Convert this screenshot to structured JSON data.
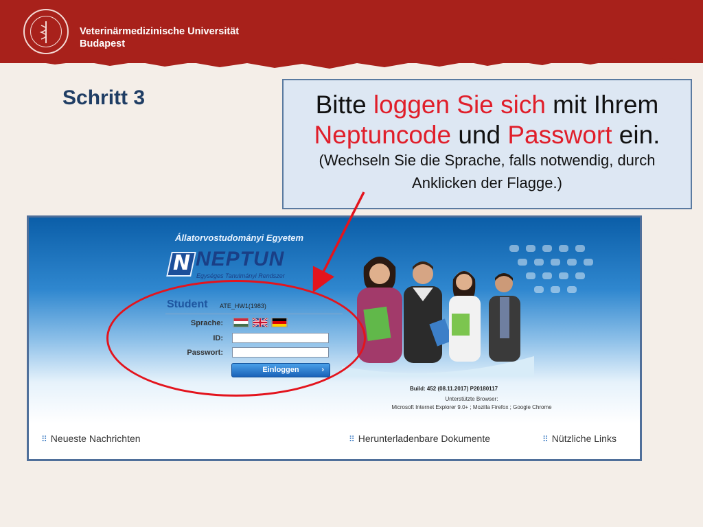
{
  "slide": {
    "university_name_line1": "Veterinärmedizinische Universität",
    "university_name_line2": "Budapest",
    "step_label": "Schritt 3",
    "colors": {
      "header": "#a8211b",
      "step": "#1f3d64",
      "highlight": "#e01e2a",
      "callout_bg": "#dde7f3"
    }
  },
  "callout": {
    "w1": "Bitte ",
    "w2": "loggen Sie sich",
    "w3": " mit Ihrem",
    "w4": "Neptuncode",
    "w5": " und ",
    "w6": "Passwort",
    "w7": " ein.",
    "hint_line1": "(Wechseln Sie die Sprache, falls notwendig, durch",
    "hint_line2": "Anklicken der Flagge.)"
  },
  "neptun": {
    "institution": "Állatorvostudományi Egyetem",
    "logo_text": "NEPTUN",
    "logo_letter": "N",
    "logo_subtitle": "Egységes Tanulmányi Rendszer",
    "login": {
      "title": "Student",
      "code": "ATE_HW1(1983)",
      "language_label": "Sprache:",
      "id_label": "ID:",
      "password_label": "Passwort:",
      "id_value": "",
      "password_value": "",
      "login_button": "Einloggen",
      "login_arrow": "›"
    },
    "build": "Build: 452 (08.11.2017) P20180117",
    "browsers_title": "Unterstützte Browser:",
    "browsers_list": "Microsoft Internet Explorer 9.0+ ; Mozilla Firefox ; Google Chrome",
    "footer_links": [
      "Neueste Nachrichten",
      "Herunterladenbare Dokumente",
      "Nützliche Links"
    ],
    "grid_icon": "⠿"
  }
}
